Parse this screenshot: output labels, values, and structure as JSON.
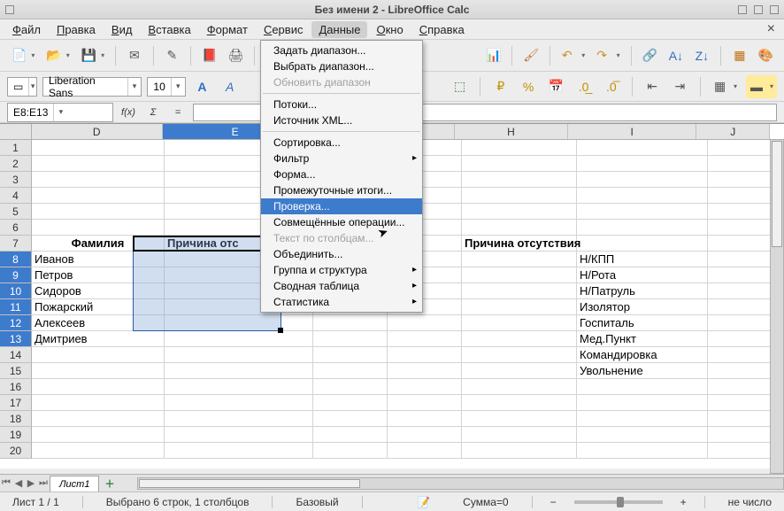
{
  "window": {
    "title": "Без имени 2 - LibreOffice Calc"
  },
  "menubar": {
    "items": [
      "Файл",
      "Правка",
      "Вид",
      "Вставка",
      "Формат",
      "Сервис",
      "Данные",
      "Окно",
      "Справка"
    ],
    "active_index": 6
  },
  "dropdown": {
    "groups": [
      {
        "items": [
          {
            "label": "Задать диапазон...",
            "enabled": true
          },
          {
            "label": "Выбрать диапазон...",
            "enabled": true
          },
          {
            "label": "Обновить диапазон",
            "enabled": false
          }
        ]
      },
      {
        "items": [
          {
            "label": "Потоки...",
            "enabled": true
          },
          {
            "label": "Источник XML...",
            "enabled": true
          }
        ]
      },
      {
        "items": [
          {
            "label": "Сортировка...",
            "enabled": true
          },
          {
            "label": "Фильтр",
            "enabled": true,
            "submenu": true
          },
          {
            "label": "Форма...",
            "enabled": true
          },
          {
            "label": "Промежуточные итоги...",
            "enabled": true
          },
          {
            "label": "Проверка...",
            "enabled": true,
            "highlight": true
          },
          {
            "label": "Совмещённые операции...",
            "enabled": true
          },
          {
            "label": "Текст по столбцам...",
            "enabled": false
          },
          {
            "label": "Объединить...",
            "enabled": true
          },
          {
            "label": "Группа и структура",
            "enabled": true,
            "submenu": true
          },
          {
            "label": "Сводная таблица",
            "enabled": true,
            "submenu": true
          },
          {
            "label": "Статистика",
            "enabled": true,
            "submenu": true
          }
        ]
      }
    ]
  },
  "font": {
    "name": "Liberation Sans",
    "size": "10"
  },
  "namebox": "E8:E13",
  "columns": {
    "visible": [
      "D",
      "E",
      "F",
      "G",
      "H",
      "I",
      "J"
    ],
    "selected": "E",
    "widths": {
      "D": 150,
      "E": 168,
      "F": 84,
      "G": 84,
      "H": 84,
      "I": 148,
      "J": 84
    }
  },
  "rows": {
    "first": 1,
    "last_visible": 20,
    "selected": [
      8,
      9,
      10,
      11,
      12,
      13
    ]
  },
  "cells": {
    "de_header": [
      "Фамилия",
      "Причина отс"
    ],
    "surnames": [
      "Иванов",
      "Петров",
      "Сидоров",
      "Пожарский",
      "Алексеев",
      "Дмитриев"
    ],
    "reasons_header": "Причина отсутствия",
    "reasons": [
      "Н/КПП",
      "Н/Рота",
      "Н/Патруль",
      "Изолятор",
      "Госпиталь",
      "Мед.Пункт",
      "Командировка",
      "Увольнение"
    ]
  },
  "sheettab": "Лист1",
  "statusbar": {
    "sheet_pos": "Лист 1 / 1",
    "selection": "Выбрано 6 строк, 1 столбцов",
    "style": "Базовый",
    "sum": "Сумма=0",
    "mode": "не число"
  },
  "colors": {
    "accent": "#3d7bcc"
  }
}
